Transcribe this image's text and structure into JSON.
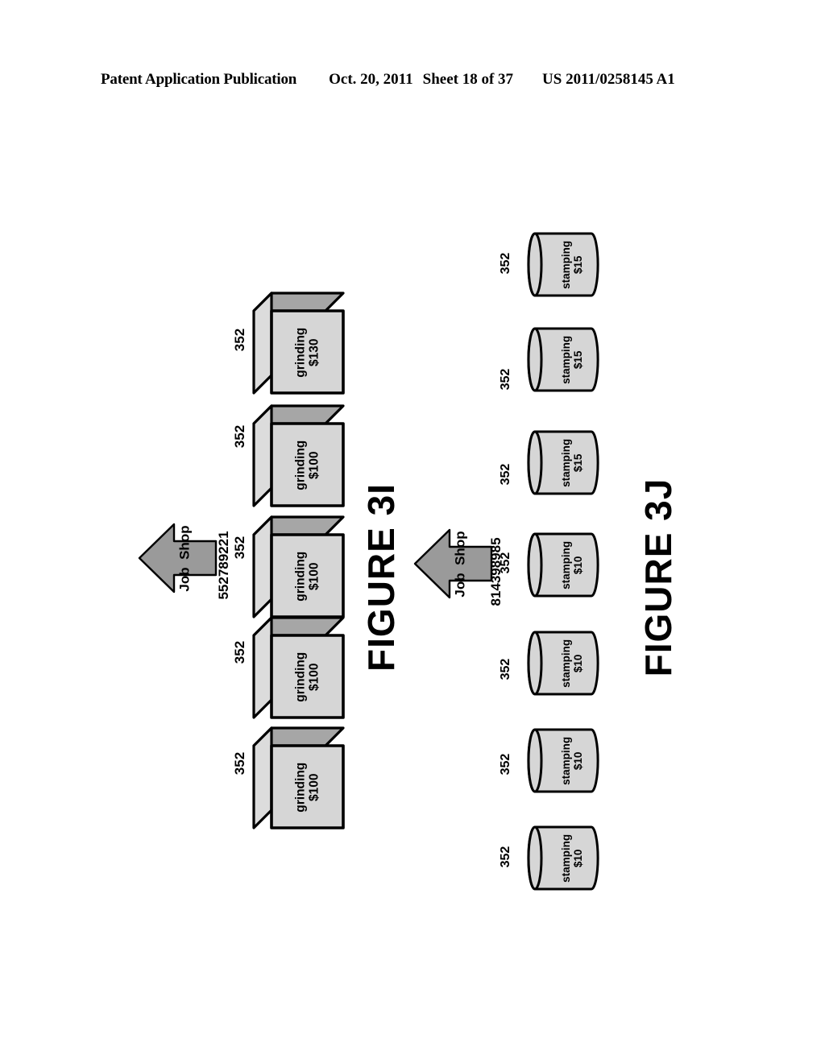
{
  "header": {
    "publication": "Patent Application Publication",
    "date": "Oct. 20, 2011",
    "sheet": "Sheet 18 of 37",
    "patent_number": "US 2011/0258145 A1"
  },
  "colors": {
    "node_fill": "#d4d4d4",
    "node_top_fill": "#a6a6a6",
    "arrow_fill": "#9a9a9a",
    "outline": "#000000",
    "background": "#ffffff"
  },
  "figures": [
    {
      "id": "figure-3i",
      "caption": "FIGURE 3I",
      "node_shape": "cube",
      "arrow": {
        "label_line1": "Job",
        "label_line2": "Shop",
        "id_number": "552789221",
        "ref_number": "352",
        "direction": "left"
      },
      "nodes": [
        {
          "ref": "352",
          "operation": "grinding",
          "cost": "$130"
        },
        {
          "ref": "352",
          "operation": "grinding",
          "cost": "$100"
        },
        {
          "ref": "352",
          "operation": "grinding",
          "cost": "$100"
        },
        {
          "ref": "352",
          "operation": "grinding",
          "cost": "$100"
        },
        {
          "ref": "352",
          "operation": "grinding",
          "cost": "$100"
        }
      ]
    },
    {
      "id": "figure-3j",
      "caption": "FIGURE 3J",
      "node_shape": "cylinder",
      "arrow": {
        "label_line1": "Job",
        "label_line2": "Shop",
        "id_number": "814398985",
        "ref_number": "352",
        "direction": "left"
      },
      "nodes": [
        {
          "ref": "352",
          "operation": "stamping",
          "cost": "$15"
        },
        {
          "ref": "352",
          "operation": "stamping",
          "cost": "$15"
        },
        {
          "ref": "352",
          "operation": "stamping",
          "cost": "$15"
        },
        {
          "ref": "352",
          "operation": "stamping",
          "cost": "$10"
        },
        {
          "ref": "352",
          "operation": "stamping",
          "cost": "$10"
        },
        {
          "ref": "352",
          "operation": "stamping",
          "cost": "$10"
        },
        {
          "ref": "352",
          "operation": "stamping",
          "cost": "$10"
        }
      ]
    }
  ]
}
